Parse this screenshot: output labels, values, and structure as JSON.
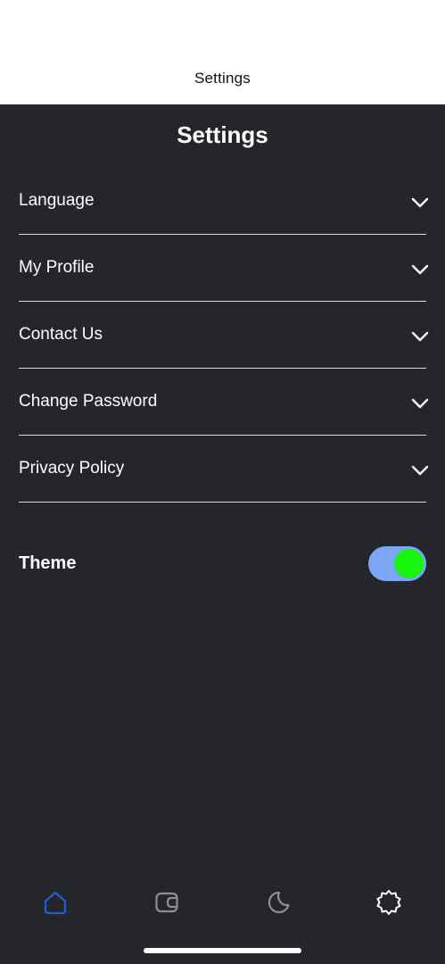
{
  "nav_bar": {
    "title": "Settings"
  },
  "page": {
    "heading": "Settings"
  },
  "settings_items": [
    {
      "label": "Language",
      "icon": "chevron-down-icon"
    },
    {
      "label": "My Profile",
      "icon": "chevron-down-icon"
    },
    {
      "label": "Contact Us",
      "icon": "chevron-down-icon"
    },
    {
      "label": "Change Password",
      "icon": "chevron-down-icon"
    },
    {
      "label": "Privacy Policy",
      "icon": "chevron-down-icon"
    }
  ],
  "theme": {
    "label": "Theme",
    "toggle_on": true,
    "track_color": "#7ea6f7",
    "knob_color": "#16f50b"
  },
  "tab_bar": {
    "tabs": [
      {
        "icon": "home-icon",
        "active": true
      },
      {
        "icon": "wallet-icon",
        "active": false
      },
      {
        "icon": "moon-icon",
        "active": false
      },
      {
        "icon": "gear-icon",
        "active": false
      }
    ]
  },
  "colors": {
    "background": "#25262c",
    "accent": "#1c5fd6",
    "inactive_icon": "#8e8e93",
    "text": "#ffffff"
  }
}
